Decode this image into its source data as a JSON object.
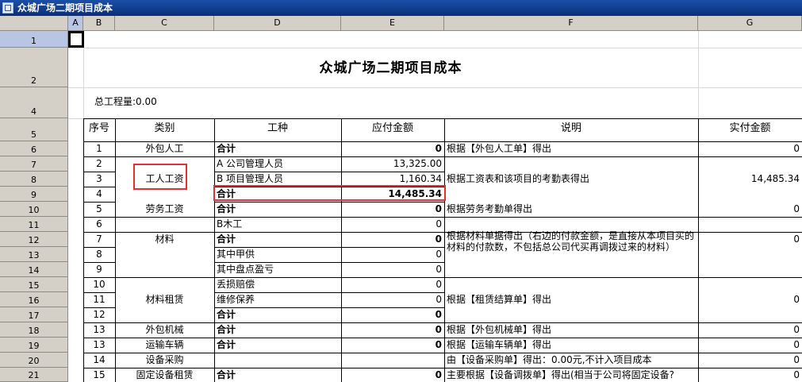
{
  "window": {
    "title": "众城广场二期项目成本"
  },
  "columns": [
    "A",
    "B",
    "C",
    "D",
    "E",
    "F",
    "G"
  ],
  "rows": [
    "1",
    "2",
    "4",
    "5",
    "6",
    "7",
    "8",
    "9",
    "10",
    "11",
    "12",
    "13",
    "14",
    "15",
    "16",
    "17",
    "18",
    "19",
    "20",
    "21"
  ],
  "sheet": {
    "title": "众城广场二期项目成本",
    "total_work": "总工程量:0.00",
    "headers": {
      "seq": "序号",
      "category": "类别",
      "work_type": "工种",
      "payable": "应付金额",
      "desc": "说明",
      "actual": "实付金额"
    },
    "table": [
      {
        "seq": "1",
        "category": "外包人工",
        "work": "合计",
        "work_bold": true,
        "amount": "0",
        "amount_bold": true,
        "desc": "根据【外包人工单】得出",
        "actual": "0"
      },
      {
        "seq": "2",
        "category": "",
        "work": "A 公司管理人员",
        "work_bold": false,
        "amount": "13,325.00",
        "amount_bold": false,
        "desc": "",
        "actual": ""
      },
      {
        "seq": "3",
        "category": "工人工资",
        "work": "B 项目管理人员",
        "work_bold": false,
        "amount": "1,160.34",
        "amount_bold": false,
        "desc": "根据工资表和该项目的考勤表得出",
        "actual": "14,485.34"
      },
      {
        "seq": "4",
        "category": "",
        "work": "合计",
        "work_bold": true,
        "amount": "14,485.34",
        "amount_bold": true,
        "desc": "",
        "actual": ""
      },
      {
        "seq": "5",
        "category": "劳务工资",
        "work": "合计",
        "work_bold": true,
        "amount": "0",
        "amount_bold": true,
        "desc": "根据劳务考勤单得出",
        "actual": "0"
      },
      {
        "seq": "6",
        "category": "",
        "work": "B木工",
        "work_bold": false,
        "amount": "0",
        "amount_bold": false,
        "desc": "",
        "actual": ""
      },
      {
        "seq": "7",
        "category": "材料",
        "work": "合计",
        "work_bold": true,
        "amount": "0",
        "amount_bold": true,
        "desc": "根据材料单据得出（右边的付款金额，是直接从本项目买的材料的付款数，不包括总公司代买再调拨过来的材料）",
        "actual": "0"
      },
      {
        "seq": "8",
        "category": "",
        "work": "其中甲供",
        "work_bold": false,
        "amount": "0",
        "amount_bold": false,
        "desc": "",
        "actual": ""
      },
      {
        "seq": "9",
        "category": "",
        "work": "其中盘点盈亏",
        "work_bold": false,
        "amount": "0",
        "amount_bold": false,
        "desc": "",
        "actual": ""
      },
      {
        "seq": "10",
        "category": "",
        "work": "丢损赔偿",
        "work_bold": false,
        "amount": "0",
        "amount_bold": false,
        "desc": "",
        "actual": ""
      },
      {
        "seq": "11",
        "category": "材料租赁",
        "work": "维修保养",
        "work_bold": false,
        "amount": "0",
        "amount_bold": false,
        "desc": "根据【租赁结算单】得出",
        "actual": "0"
      },
      {
        "seq": "12",
        "category": "",
        "work": "合计",
        "work_bold": true,
        "amount": "0",
        "amount_bold": true,
        "desc": "",
        "actual": ""
      },
      {
        "seq": "13",
        "category": "外包机械",
        "work": "合计",
        "work_bold": true,
        "amount": "0",
        "amount_bold": true,
        "desc": "根据【外包机械单】得出",
        "actual": "0"
      },
      {
        "seq": "13",
        "category": "运输车辆",
        "work": "合计",
        "work_bold": true,
        "amount": "0",
        "amount_bold": true,
        "desc": "根据【运输车辆单】得出",
        "actual": "0"
      },
      {
        "seq": "14",
        "category": "设备采购",
        "work": "",
        "work_bold": false,
        "amount": "",
        "amount_bold": false,
        "desc": "由【设备采购单】得出：0.00元,不计入项目成本",
        "actual": "0"
      },
      {
        "seq": "15",
        "category": "固定设备租赁",
        "work": "合计",
        "work_bold": true,
        "amount": "0",
        "amount_bold": true,
        "desc": "主要根据【设备调拨单】得出(相当于公司将固定设备?",
        "actual": "0"
      }
    ]
  }
}
